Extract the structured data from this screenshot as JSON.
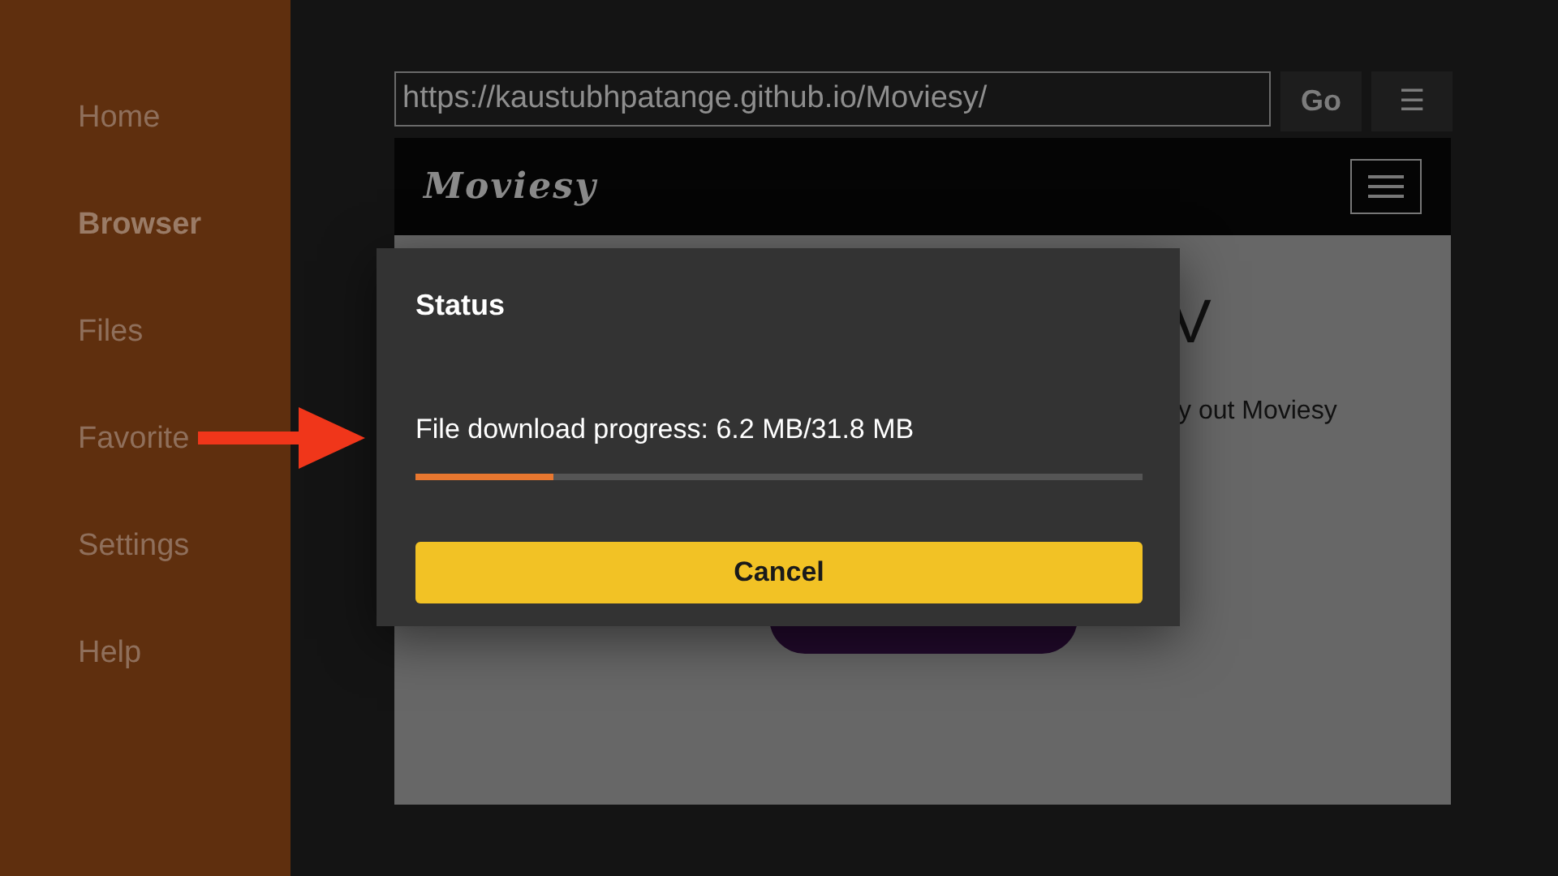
{
  "sidebar": {
    "items": [
      {
        "label": "Home",
        "selected": false
      },
      {
        "label": "Browser",
        "selected": true
      },
      {
        "label": "Files",
        "selected": false
      },
      {
        "label": "Favorite",
        "selected": false
      },
      {
        "label": "Settings",
        "selected": false
      },
      {
        "label": "Help",
        "selected": false
      }
    ]
  },
  "browser": {
    "url": "https://kaustubhpatange.github.io/Moviesy/",
    "go_button": "Go",
    "menu_button": "☰"
  },
  "web_page": {
    "logo": "Moviesy",
    "heading": "V",
    "text": "y out Moviesy"
  },
  "dialog": {
    "title": "Status",
    "message": "File download progress: 6.2 MB/31.8 MB",
    "progress": {
      "level": 0.19
    },
    "button": "Cancel"
  }
}
